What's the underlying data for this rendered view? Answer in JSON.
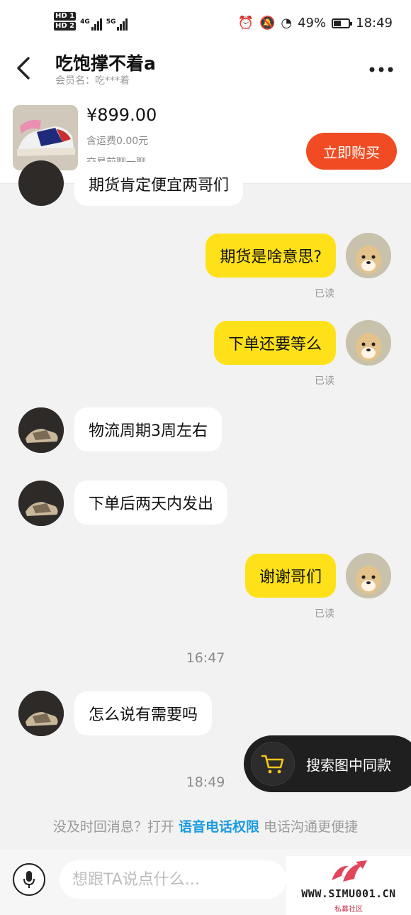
{
  "status": {
    "hd1": "HD 1",
    "hd2": "HD 2",
    "net1": "4G",
    "net2": "5G",
    "battery_percent": "49%",
    "battery_level": 0.49,
    "time": "18:49"
  },
  "header": {
    "title": "吃饱撑不着a",
    "subtitle": "会员名：吃***着"
  },
  "product": {
    "price": "¥899.00",
    "shipping": "含运费0.00元",
    "note": "交易前聊一聊",
    "buy_label": "立即购买"
  },
  "messages": [
    {
      "side": "left",
      "text": "期货肯定便宜两哥们"
    },
    {
      "side": "right",
      "text": "期货是啥意思?",
      "status": "已读"
    },
    {
      "side": "right",
      "text": "下单还要等么",
      "status": "已读"
    },
    {
      "side": "left",
      "text": "物流周期3周左右"
    },
    {
      "side": "left",
      "text": "下单后两天内发出"
    },
    {
      "side": "right",
      "text": "谢谢哥们",
      "status": "已读"
    },
    {
      "side": "left",
      "text": "怎么说有需要吗"
    }
  ],
  "timestamps": [
    "16:47",
    "18:49"
  ],
  "float_button": {
    "label": "搜索图中同款",
    "icon": "cart-icon"
  },
  "notice": {
    "prefix": "没及时回消息？打开",
    "link": "语音电话权限",
    "suffix": "电话沟通更便捷"
  },
  "input": {
    "placeholder": "想跟TA说点什么..."
  },
  "watermark": {
    "text": "WWW.SIMU001.CN",
    "sub": "私募社区"
  },
  "colors": {
    "accent": "#f04b22",
    "my_bubble": "#ffe11a",
    "link": "#1a9be0"
  }
}
